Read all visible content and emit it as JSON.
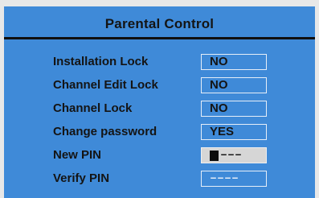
{
  "dialog": {
    "title": "Parental Control"
  },
  "settings": [
    {
      "label": "Installation Lock",
      "value": "NO"
    },
    {
      "label": "Channel Edit Lock",
      "value": "NO"
    },
    {
      "label": "Channel Lock",
      "value": "NO"
    },
    {
      "label": "Change password",
      "value": "YES"
    }
  ],
  "pins": [
    {
      "label": "New PIN",
      "entered": "",
      "mask": "–––",
      "focused": true
    },
    {
      "label": "Verify PIN",
      "entered": "",
      "mask": "––––",
      "focused": false
    }
  ],
  "colors": {
    "panel": "#3f8ad8",
    "text": "#141414",
    "field_border": "#e6eef8",
    "focused_field": "#d6d6d6"
  }
}
